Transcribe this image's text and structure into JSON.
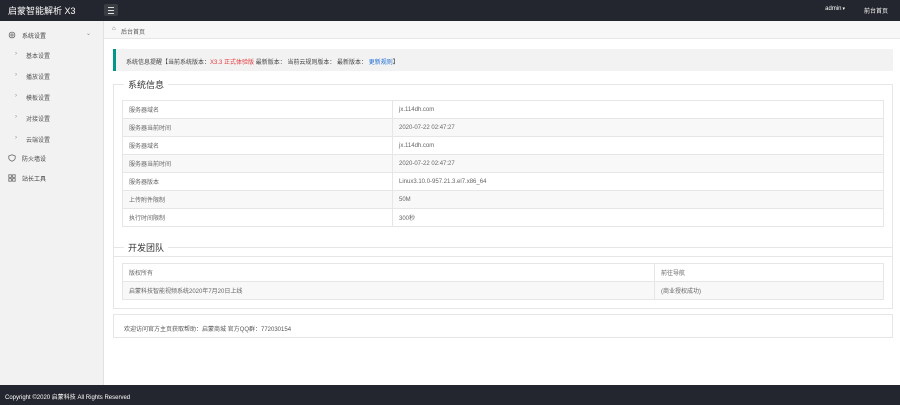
{
  "topbar": {
    "brand": "启蒙智能解析 X3",
    "user": "admin",
    "home_link": "前台首页"
  },
  "sidebar": {
    "groups": [
      {
        "label": "系统设置",
        "icon": "gear-icon"
      },
      {
        "label": "防火墙设",
        "icon": "shield-icon"
      },
      {
        "label": "站长工具",
        "icon": "tools-icon"
      }
    ],
    "items": [
      {
        "label": "基本设置"
      },
      {
        "label": "播放设置"
      },
      {
        "label": "模板设置"
      },
      {
        "label": "对接设置"
      },
      {
        "label": "云端设置"
      }
    ]
  },
  "breadcrumb": {
    "text": "后台首页"
  },
  "notice": {
    "prefix": "系统信息提醒【当前系统版本：",
    "version": "X3.3 正式体验版",
    "latest_label": " 最新版本：",
    "cloud_label": " 当前云规则版本：",
    "latest_rule_label": " 最新版本：",
    "update_rule": "更新规则",
    "suffix": "】"
  },
  "system_info": {
    "title": "系统信息",
    "rows": [
      {
        "label": "服务器域名",
        "value": "jx.114dh.com"
      },
      {
        "label": "服务器当前时间",
        "value": "2020-07-22 02:47:27"
      },
      {
        "label": "服务器域名",
        "value": "jx.114dh.com"
      },
      {
        "label": "服务器当前时间",
        "value": "2020-07-22 02:47:27"
      },
      {
        "label": "服务器版本",
        "value": "Linux3.10.0-957.21.3.el7.x86_64"
      },
      {
        "label": "上传附件限制",
        "value": "50M"
      },
      {
        "label": "执行时间限制",
        "value": "300秒"
      }
    ]
  },
  "dev_team": {
    "title": "开发团队",
    "rows": [
      {
        "label": "版权所有",
        "value": "前往导航"
      },
      {
        "label": "启蒙科技智能视频系统2020年7月20日上线",
        "value": "(商业授权成功)"
      }
    ]
  },
  "footer_note": "欢迎访问官方主页获取帮助：启蒙商城 官方QQ群：772030154",
  "copyright": "Copyright ©2020 启蒙科技 All Rights Reserved",
  "colors": {
    "accent": "#009688",
    "dark": "#23262e",
    "red": "#e4393c",
    "blue": "#1e6cd4"
  }
}
